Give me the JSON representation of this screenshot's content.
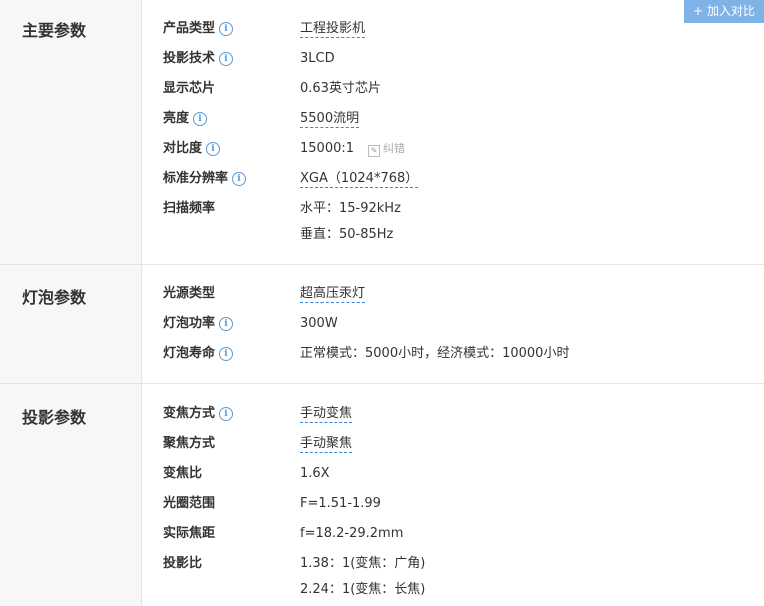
{
  "compare_button": {
    "label": "加入对比",
    "plus": "+"
  },
  "info_icon": "i",
  "sections": {
    "main": {
      "title": "主要参数",
      "rows": {
        "product_type": {
          "label": "产品类型",
          "value": "工程投影机"
        },
        "projection_tech": {
          "label": "投影技术",
          "value": "3LCD"
        },
        "display_chip": {
          "label": "显示芯片",
          "value": "0.63英寸芯片"
        },
        "brightness": {
          "label": "亮度",
          "value": "5500流明"
        },
        "contrast": {
          "label": "对比度",
          "value": "15000:1",
          "fix": "纠错"
        },
        "resolution": {
          "label": "标准分辨率",
          "value": "XGA（1024*768）"
        },
        "scan_freq": {
          "label": "扫描频率",
          "value": "水平：15-92kHz",
          "value2": "垂直：50-85Hz"
        }
      }
    },
    "lamp": {
      "title": "灯泡参数",
      "rows": {
        "light_source": {
          "label": "光源类型",
          "value": "超高压汞灯"
        },
        "lamp_power": {
          "label": "灯泡功率",
          "value": "300W"
        },
        "lamp_life": {
          "label": "灯泡寿命",
          "value": "正常模式：5000小时，经济模式：10000小时"
        }
      }
    },
    "projection": {
      "title": "投影参数",
      "rows": {
        "zoom_mode": {
          "label": "变焦方式",
          "value": "手动变焦"
        },
        "focus_mode": {
          "label": "聚焦方式",
          "value": "手动聚焦"
        },
        "zoom_ratio": {
          "label": "变焦比",
          "value": "1.6X"
        },
        "aperture": {
          "label": "光圈范围",
          "value": "F=1.51-1.99"
        },
        "focal_length": {
          "label": "实际焦距",
          "value": "f=18.2-29.2mm"
        },
        "throw_ratio": {
          "label": "投影比",
          "value": "1.38：1(变焦：广角)",
          "value2": "2.24：1(变焦：长焦)"
        }
      }
    }
  }
}
